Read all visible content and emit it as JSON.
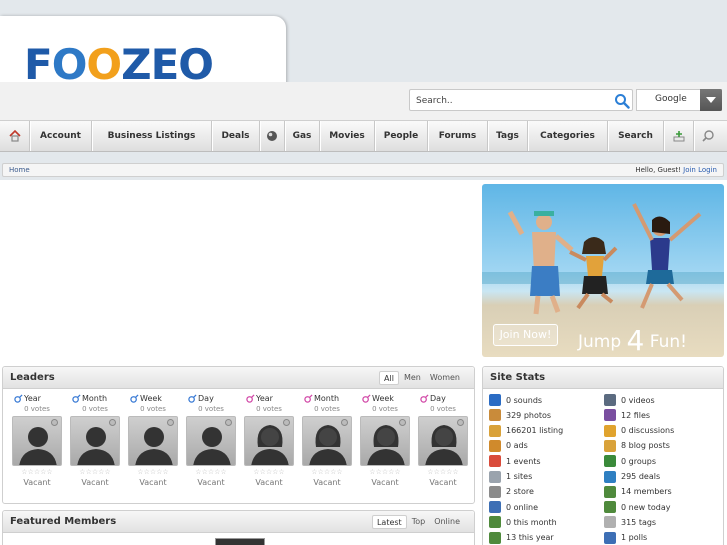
{
  "logo": {
    "text_f": "F",
    "text_o1": "O",
    "text_o2": "O",
    "text_zeo": "ZEO"
  },
  "search": {
    "placeholder": "Search..",
    "engine": "Google"
  },
  "nav": {
    "items": [
      "Account",
      "Business Listings",
      "Deals",
      "Gas",
      "Movies",
      "People",
      "Forums",
      "Tags",
      "Categories",
      "Search"
    ]
  },
  "breadcrumb": {
    "home": "Home",
    "greeting": "Hello, Guest!",
    "join": "Join",
    "login": "Login"
  },
  "banner": {
    "join_button": "Join Now!",
    "slogan_a": "Jump",
    "slogan_num": "4",
    "slogan_b": "Fun!"
  },
  "leaders": {
    "title": "Leaders",
    "tabs": [
      "All",
      "Men",
      "Women"
    ],
    "columns": [
      {
        "period": "Year",
        "votes": "0 votes",
        "gender": "male",
        "status": "Vacant"
      },
      {
        "period": "Month",
        "votes": "0 votes",
        "gender": "male",
        "status": "Vacant"
      },
      {
        "period": "Week",
        "votes": "0 votes",
        "gender": "male",
        "status": "Vacant"
      },
      {
        "period": "Day",
        "votes": "0 votes",
        "gender": "male",
        "status": "Vacant"
      },
      {
        "period": "Year",
        "votes": "0 votes",
        "gender": "female",
        "status": "Vacant"
      },
      {
        "period": "Month",
        "votes": "0 votes",
        "gender": "female",
        "status": "Vacant"
      },
      {
        "period": "Week",
        "votes": "0 votes",
        "gender": "female",
        "status": "Vacant"
      },
      {
        "period": "Day",
        "votes": "0 votes",
        "gender": "female",
        "status": "Vacant"
      }
    ],
    "stars": "☆☆☆☆☆"
  },
  "featured": {
    "title": "Featured Members",
    "tabs": [
      "Latest",
      "Top",
      "Online"
    ]
  },
  "site_stats": {
    "title": "Site Stats",
    "left": [
      {
        "icon": "music-note-icon",
        "label": "0 sounds",
        "color": "#2b6cc4"
      },
      {
        "icon": "photos-icon",
        "label": "329 photos",
        "color": "#c98b3a"
      },
      {
        "icon": "listing-icon",
        "label": "166201 listing",
        "color": "#d9a23a"
      },
      {
        "icon": "ads-icon",
        "label": "0 ads",
        "color": "#d08a2c"
      },
      {
        "icon": "calendar-icon",
        "label": "1 events",
        "color": "#d94b3b"
      },
      {
        "icon": "sites-icon",
        "label": "1 sites",
        "color": "#9aa3ad"
      },
      {
        "icon": "cart-icon",
        "label": "2 store",
        "color": "#8b8b8b"
      },
      {
        "icon": "online-user-icon",
        "label": "0 online",
        "color": "#3d6fb5"
      },
      {
        "icon": "users-month-icon",
        "label": "0 this month",
        "color": "#4f8a3c"
      },
      {
        "icon": "users-year-icon",
        "label": "13 this year",
        "color": "#4f8a3c"
      }
    ],
    "right": [
      {
        "icon": "film-icon",
        "label": "0 videos",
        "color": "#5b6b80"
      },
      {
        "icon": "files-icon",
        "label": "12 files",
        "color": "#7a4fa0"
      },
      {
        "icon": "discussions-icon",
        "label": "0 discussions",
        "color": "#e0a32e"
      },
      {
        "icon": "blog-icon",
        "label": "8 blog posts",
        "color": "#d9a23a"
      },
      {
        "icon": "groups-icon",
        "label": "0 groups",
        "color": "#3a8a3a"
      },
      {
        "icon": "deals-icon",
        "label": "295 deals",
        "color": "#2f7fc1"
      },
      {
        "icon": "members-icon",
        "label": "14 members",
        "color": "#4f8a3c"
      },
      {
        "icon": "new-today-icon",
        "label": "0 new today",
        "color": "#4f8a3c"
      },
      {
        "icon": "tags-icon",
        "label": "315 tags",
        "color": "#b0b0b0"
      },
      {
        "icon": "polls-icon",
        "label": "1 polls",
        "color": "#3d6fb5"
      }
    ]
  }
}
